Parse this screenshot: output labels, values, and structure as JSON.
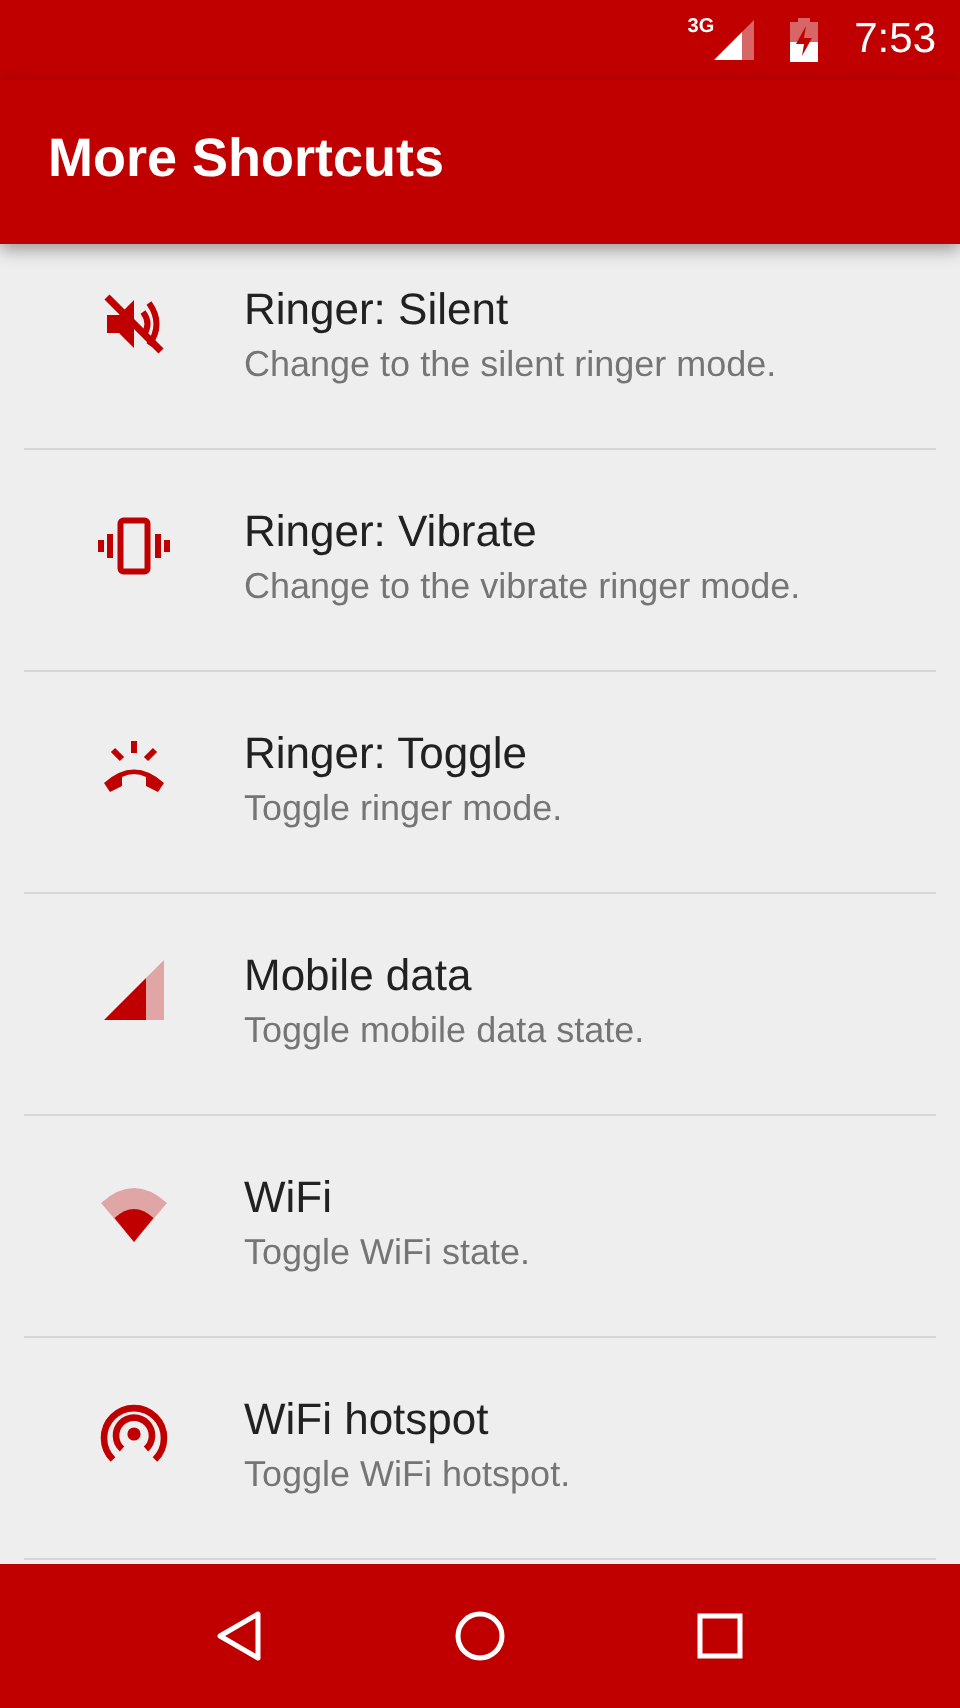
{
  "status_bar": {
    "network": "3G",
    "time": "7:53"
  },
  "app_bar": {
    "title": "More Shortcuts"
  },
  "shortcuts": [
    {
      "kind": "silent",
      "title": "Ringer: Silent",
      "subtitle": "Change to the silent ringer mode."
    },
    {
      "kind": "vibrate",
      "title": "Ringer: Vibrate",
      "subtitle": "Change to the vibrate ringer mode."
    },
    {
      "kind": "ring",
      "title": "Ringer: Toggle",
      "subtitle": "Toggle ringer mode."
    },
    {
      "kind": "signal",
      "title": "Mobile data",
      "subtitle": "Toggle mobile data state."
    },
    {
      "kind": "wifi",
      "title": "WiFi",
      "subtitle": "Toggle WiFi state."
    },
    {
      "kind": "hotspot",
      "title": "WiFi hotspot",
      "subtitle": "Toggle WiFi hotspot."
    }
  ]
}
